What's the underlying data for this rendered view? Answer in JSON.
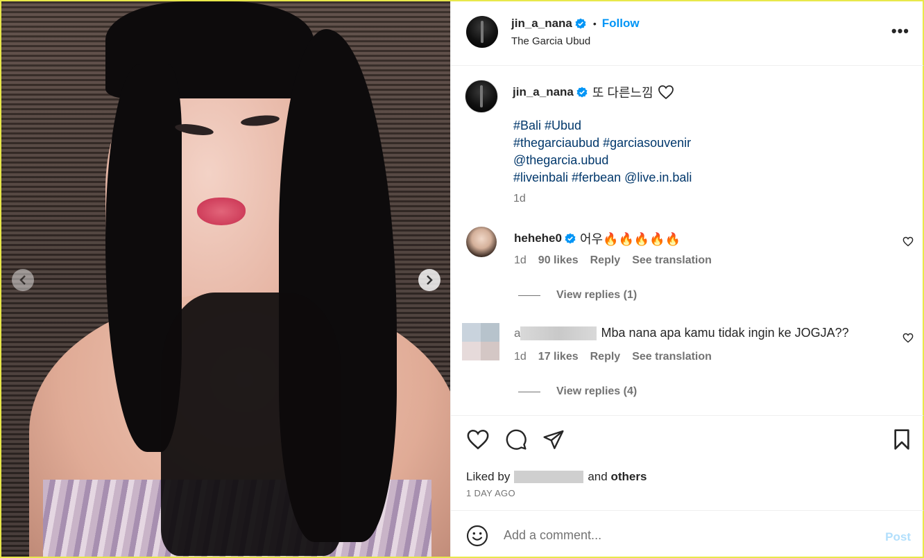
{
  "post": {
    "author": "jin_a_nana",
    "follow_label": "Follow",
    "separator": "•",
    "location": "The Garcia Ubud",
    "more_label": "•••"
  },
  "caption": {
    "author": "jin_a_nana",
    "text": "또 다른느낌",
    "tag_lines": [
      "#Bali #Ubud",
      "#thegarciaubud #garciasouvenir",
      "@thegarcia.ubud",
      "#liveinbali #ferbean @live.in.bali"
    ],
    "time": "1d"
  },
  "comments": [
    {
      "author": "hehehe0",
      "text": "어우🔥🔥🔥🔥🔥",
      "time": "1d",
      "likes": "90 likes",
      "reply_label": "Reply",
      "translate_label": "See translation",
      "view_replies": "View replies (1)"
    },
    {
      "author_prefix": "a",
      "text": "Mba nana apa kamu tidak ingin ke JOGJA??",
      "time": "1d",
      "likes": "17 likes",
      "reply_label": "Reply",
      "translate_label": "See translation",
      "view_replies": "View replies (4)"
    }
  ],
  "likes": {
    "prefix": "Liked by",
    "middle": "and",
    "others": "others",
    "time": "1 DAY AGO"
  },
  "composer": {
    "placeholder": "Add a comment...",
    "post_label": "Post"
  },
  "icons": {
    "verified": "verified-badge-icon",
    "like": "heart-icon",
    "comment": "comment-bubble-icon",
    "share": "paper-plane-icon",
    "save": "bookmark-icon",
    "emoji": "smiley-icon",
    "prev": "chevron-left-icon",
    "next": "chevron-right-icon"
  },
  "colors": {
    "link": "#0095f6",
    "hashtag": "#00376b",
    "muted": "#737373",
    "verified": "#0095f6",
    "border_highlight": "#e8e84a"
  }
}
